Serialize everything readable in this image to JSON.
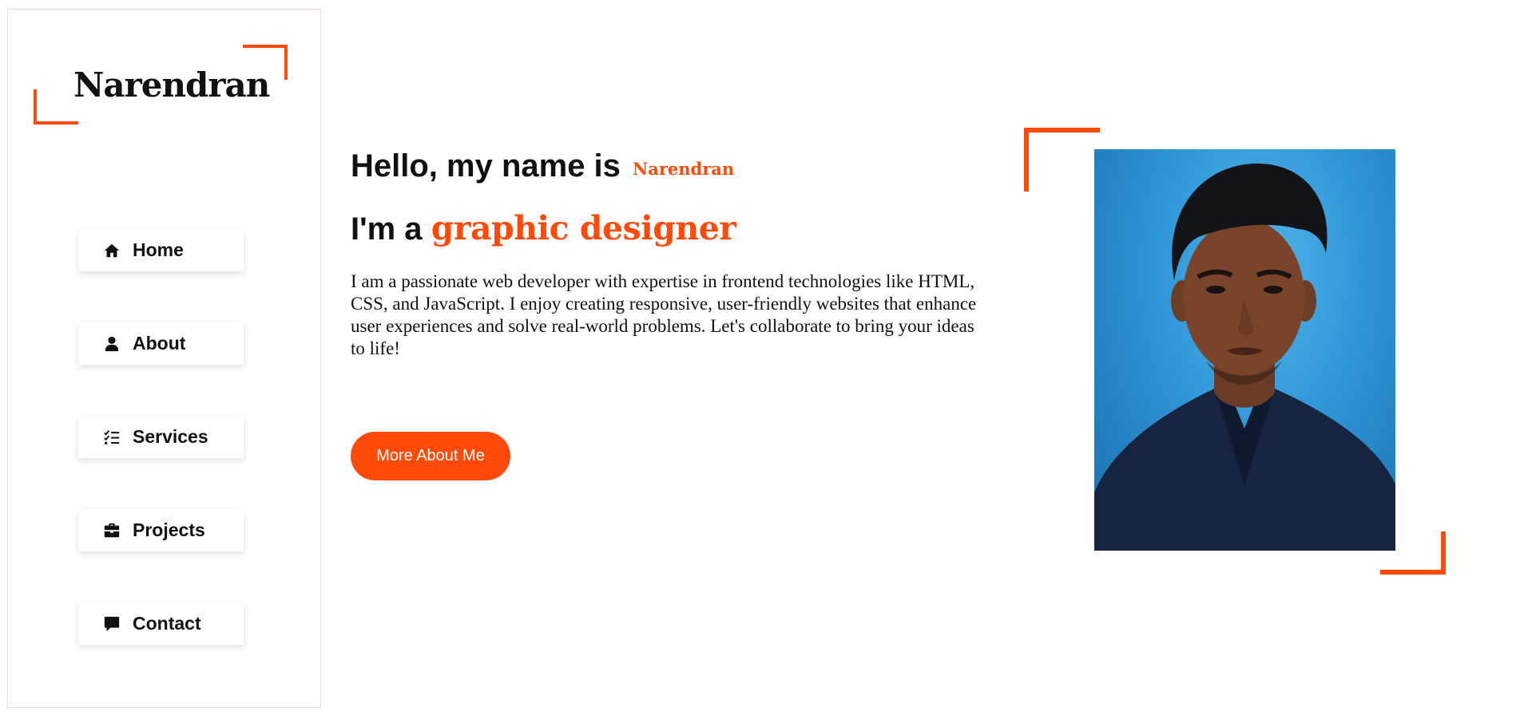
{
  "sidebar": {
    "logo": "Narendran",
    "items": [
      {
        "label": "Home",
        "icon": "home-icon"
      },
      {
        "label": "About",
        "icon": "user-icon"
      },
      {
        "label": "Services",
        "icon": "list-check-icon"
      },
      {
        "label": "Projects",
        "icon": "briefcase-icon"
      },
      {
        "label": "Contact",
        "icon": "comment-icon"
      }
    ]
  },
  "hero": {
    "greeting": "Hello, my name is",
    "name": "Narendran",
    "role_prefix": "I'm a",
    "role": "graphic designer",
    "bio": "I am a passionate web developer with expertise in frontend technologies like HTML, CSS, and JavaScript. I enjoy creating responsive, user-friendly websites that enhance user experiences and solve real-world problems. Let's collaborate to bring your ideas to life!",
    "cta_label": "More About Me"
  },
  "colors": {
    "accent": "#ff4a0a",
    "text": "#111111",
    "background": "#ffffff",
    "sidebar_border": "#f3d6dc"
  }
}
